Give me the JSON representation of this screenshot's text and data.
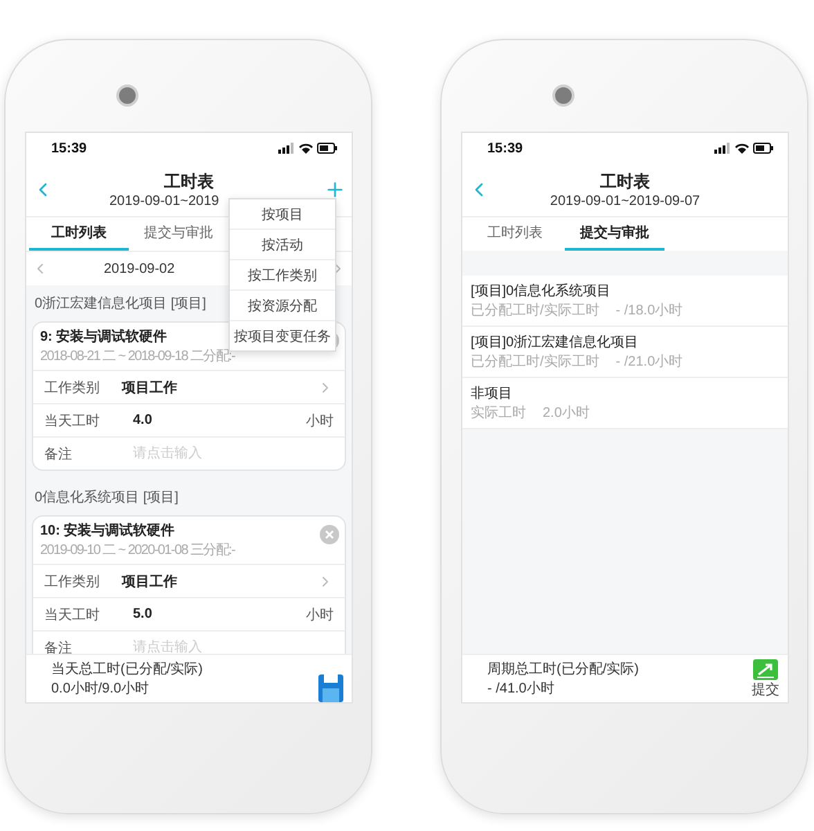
{
  "screens": [
    {
      "status_time": "15:39",
      "nav": {
        "title": "工时表",
        "subtitle": "2019-09-01~2019"
      },
      "tabs": [
        {
          "label": "工时列表",
          "selected": true
        },
        {
          "label": "提交与审批",
          "selected": false
        }
      ],
      "date_nav": {
        "date": "2019-09-02"
      },
      "dropdown_menu": [
        "按项目",
        "按活动",
        "按工作类别",
        "按资源分配",
        "按项目变更任务"
      ],
      "groups": [
        {
          "header": "0浙江宏建信息化项目 [项目]",
          "tasks": [
            {
              "title": "9: 安装与调试软硬件",
              "dates": "2018-08-21 二 ~ 2018-09-18 二分配:-",
              "fields": [
                {
                  "kind": "select",
                  "label": "工作类别",
                  "value": "项目工作"
                },
                {
                  "kind": "hours",
                  "label": "当天工时",
                  "value": "4.0",
                  "unit": "小时"
                },
                {
                  "kind": "input",
                  "label": "备注",
                  "placeholder": "请点击输入"
                }
              ]
            }
          ]
        },
        {
          "header": "0信息化系统项目 [项目]",
          "tasks": [
            {
              "title": "10: 安装与调试软硬件",
              "dates": "2019-09-10 二 ~ 2020-01-08 三分配:-",
              "fields": [
                {
                  "kind": "select",
                  "label": "工作类别",
                  "value": "项目工作"
                },
                {
                  "kind": "hours",
                  "label": "当天工时",
                  "value": "5.0",
                  "unit": "小时"
                },
                {
                  "kind": "input",
                  "label": "备注",
                  "placeholder": "请点击输入"
                }
              ]
            }
          ]
        }
      ],
      "footer": {
        "label": "当天总工时(已分配/实际)",
        "value": "0.0小时/9.0小时",
        "action": {
          "kind": "save"
        }
      }
    },
    {
      "status_time": "15:39",
      "nav": {
        "title": "工时表",
        "subtitle": "2019-09-01~2019-09-07"
      },
      "tabs": [
        {
          "label": "工时列表",
          "selected": false
        },
        {
          "label": "提交与审批",
          "selected": true
        }
      ],
      "summary_items": [
        {
          "title": "[项目]0信息化系统项目",
          "label": "已分配工时/实际工时",
          "value": "- /18.0小时"
        },
        {
          "title": "[项目]0浙江宏建信息化项目",
          "label": "已分配工时/实际工时",
          "value": "- /21.0小时"
        },
        {
          "title": "非项目",
          "label": "实际工时",
          "value": "2.0小时"
        }
      ],
      "footer": {
        "label": "周期总工时(已分配/实际)",
        "value": "- /41.0小时",
        "action": {
          "kind": "submit",
          "label": "提交"
        }
      }
    }
  ]
}
